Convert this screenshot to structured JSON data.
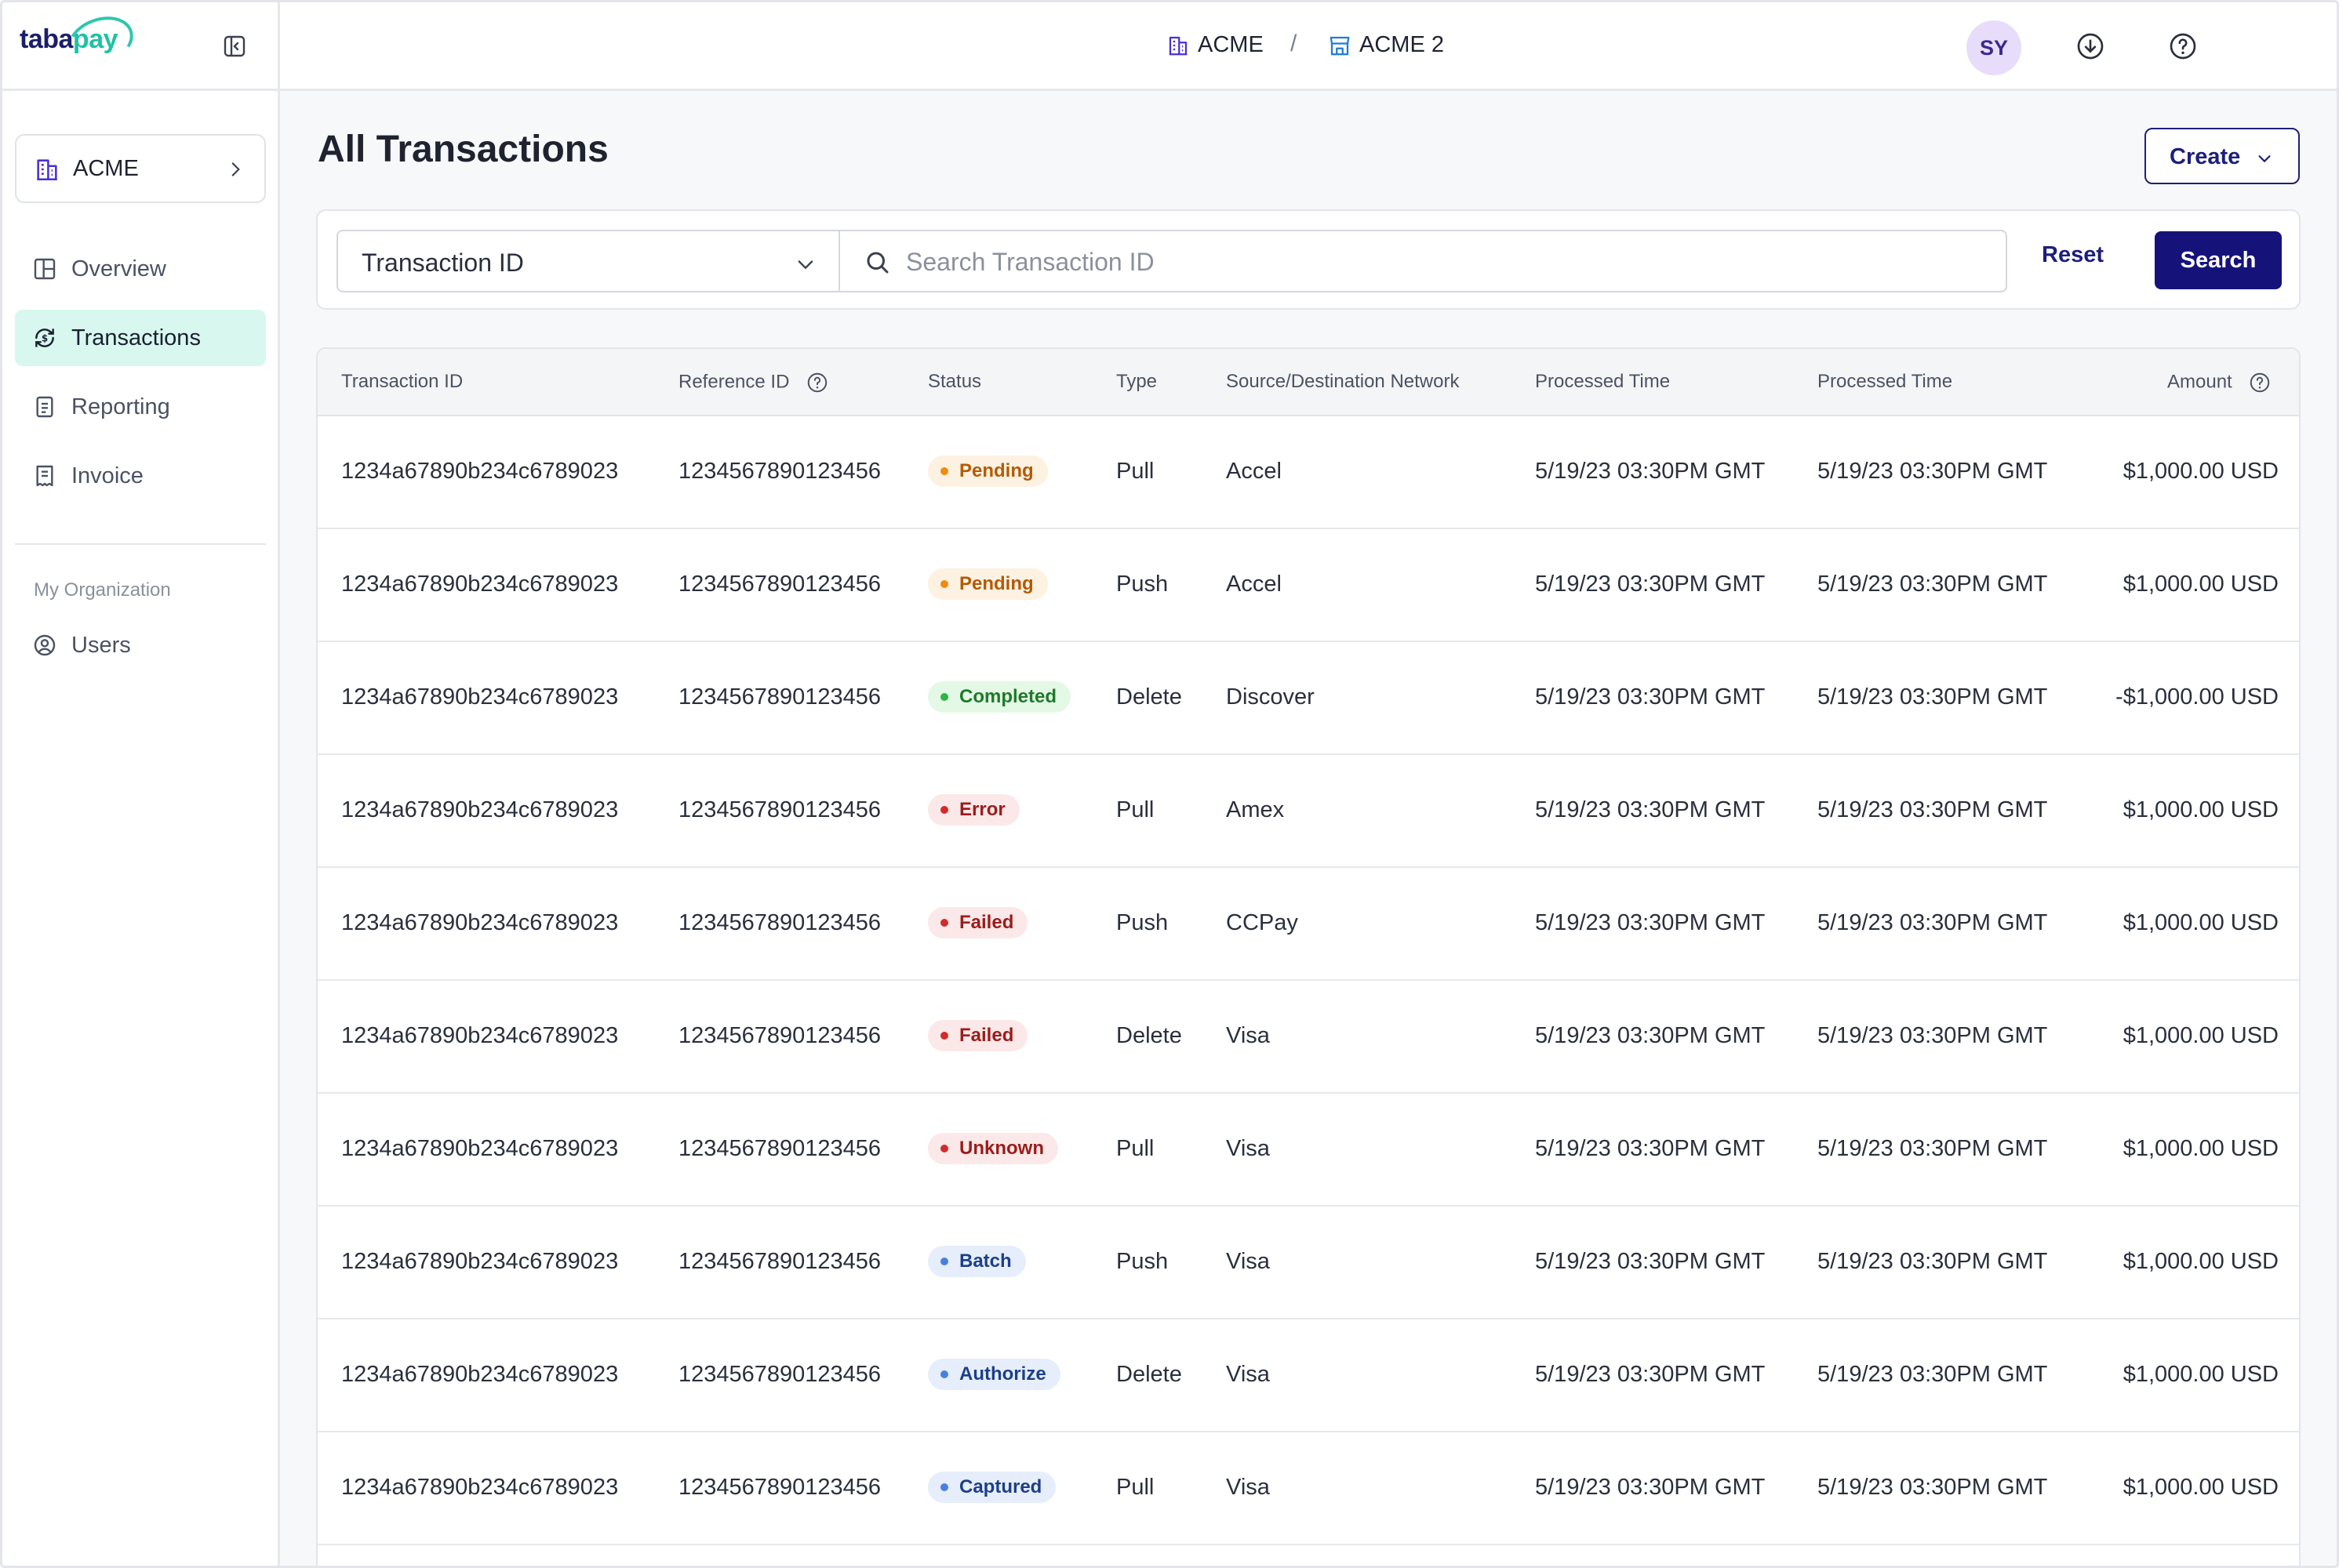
{
  "app": {
    "logo_part1": "taba",
    "logo_part2": "pay"
  },
  "sidebar": {
    "org_label": "ACME",
    "items": [
      {
        "label": "Overview",
        "icon": "overview-icon"
      },
      {
        "label": "Transactions",
        "icon": "transactions-icon",
        "active": true
      },
      {
        "label": "Reporting",
        "icon": "reporting-icon"
      },
      {
        "label": "Invoice",
        "icon": "invoice-icon"
      }
    ],
    "section_title": "My Organization",
    "section_items": [
      {
        "label": "Users",
        "icon": "users-icon"
      }
    ]
  },
  "topbar": {
    "crumb1": "ACME",
    "separator": "/",
    "crumb2": "ACME 2",
    "avatar_initials": "SY"
  },
  "main": {
    "title": "All Transactions",
    "create_label": "Create"
  },
  "search": {
    "select_value": "Transaction ID",
    "placeholder": "Search Transaction ID",
    "reset_label": "Reset",
    "search_label": "Search"
  },
  "table": {
    "headers": {
      "transaction_id": "Transaction ID",
      "reference_id": "Reference ID",
      "status": "Status",
      "type": "Type",
      "network": "Source/Destination Network",
      "processed1": "Processed Time",
      "processed2": "Processed Time",
      "amount": "Amount"
    },
    "rows": [
      {
        "txn": "1234a67890b234c6789023",
        "ref": "1234567890123456",
        "status": "Pending",
        "type": "Pull",
        "network": "Accel",
        "t1": "5/19/23 03:30PM GMT",
        "t2": "5/19/23 03:30PM GMT",
        "amount": "$1,000.00 USD"
      },
      {
        "txn": "1234a67890b234c6789023",
        "ref": "1234567890123456",
        "status": "Pending",
        "type": "Push",
        "network": "Accel",
        "t1": "5/19/23 03:30PM GMT",
        "t2": "5/19/23 03:30PM GMT",
        "amount": "$1,000.00 USD"
      },
      {
        "txn": "1234a67890b234c6789023",
        "ref": "1234567890123456",
        "status": "Completed",
        "type": "Delete",
        "network": "Discover",
        "t1": "5/19/23 03:30PM GMT",
        "t2": "5/19/23 03:30PM GMT",
        "amount": "-$1,000.00 USD"
      },
      {
        "txn": "1234a67890b234c6789023",
        "ref": "1234567890123456",
        "status": "Error",
        "type": "Pull",
        "network": "Amex",
        "t1": "5/19/23 03:30PM GMT",
        "t2": "5/19/23 03:30PM GMT",
        "amount": "$1,000.00 USD"
      },
      {
        "txn": "1234a67890b234c6789023",
        "ref": "1234567890123456",
        "status": "Failed",
        "type": "Push",
        "network": "CCPay",
        "t1": "5/19/23 03:30PM GMT",
        "t2": "5/19/23 03:30PM GMT",
        "amount": "$1,000.00 USD"
      },
      {
        "txn": "1234a67890b234c6789023",
        "ref": "1234567890123456",
        "status": "Failed",
        "type": "Delete",
        "network": "Visa",
        "t1": "5/19/23 03:30PM GMT",
        "t2": "5/19/23 03:30PM GMT",
        "amount": "$1,000.00 USD"
      },
      {
        "txn": "1234a67890b234c6789023",
        "ref": "1234567890123456",
        "status": "Unknown",
        "type": "Pull",
        "network": "Visa",
        "t1": "5/19/23 03:30PM GMT",
        "t2": "5/19/23 03:30PM GMT",
        "amount": "$1,000.00 USD"
      },
      {
        "txn": "1234a67890b234c6789023",
        "ref": "1234567890123456",
        "status": "Batch",
        "type": "Push",
        "network": "Visa",
        "t1": "5/19/23 03:30PM GMT",
        "t2": "5/19/23 03:30PM GMT",
        "amount": "$1,000.00 USD"
      },
      {
        "txn": "1234a67890b234c6789023",
        "ref": "1234567890123456",
        "status": "Authorize",
        "type": "Delete",
        "network": "Visa",
        "t1": "5/19/23 03:30PM GMT",
        "t2": "5/19/23 03:30PM GMT",
        "amount": "$1,000.00 USD"
      },
      {
        "txn": "1234a67890b234c6789023",
        "ref": "1234567890123456",
        "status": "Captured",
        "type": "Pull",
        "network": "Visa",
        "t1": "5/19/23 03:30PM GMT",
        "t2": "5/19/23 03:30PM GMT",
        "amount": "$1,000.00 USD"
      }
    ]
  },
  "status_colors": {
    "Pending": {
      "bg": "#fdf1e2",
      "fg": "#b25b05",
      "dot": "#f08a12"
    },
    "Completed": {
      "bg": "#e4f8e6",
      "fg": "#1f7a2a",
      "dot": "#2cb34a"
    },
    "Error": {
      "bg": "#fbe8e8",
      "fg": "#9b1c1c",
      "dot": "#d12b2b"
    },
    "Failed": {
      "bg": "#fbe8e8",
      "fg": "#9b1c1c",
      "dot": "#d12b2b"
    },
    "Unknown": {
      "bg": "#fbe8e8",
      "fg": "#9b1c1c",
      "dot": "#d12b2b"
    },
    "Batch": {
      "bg": "#e6eefb",
      "fg": "#1d3f8a",
      "dot": "#4a7fe0"
    },
    "Authorize": {
      "bg": "#e6eefb",
      "fg": "#1d3f8a",
      "dot": "#4a7fe0"
    },
    "Captured": {
      "bg": "#e6eefb",
      "fg": "#1d3f8a",
      "dot": "#4a7fe0"
    }
  }
}
